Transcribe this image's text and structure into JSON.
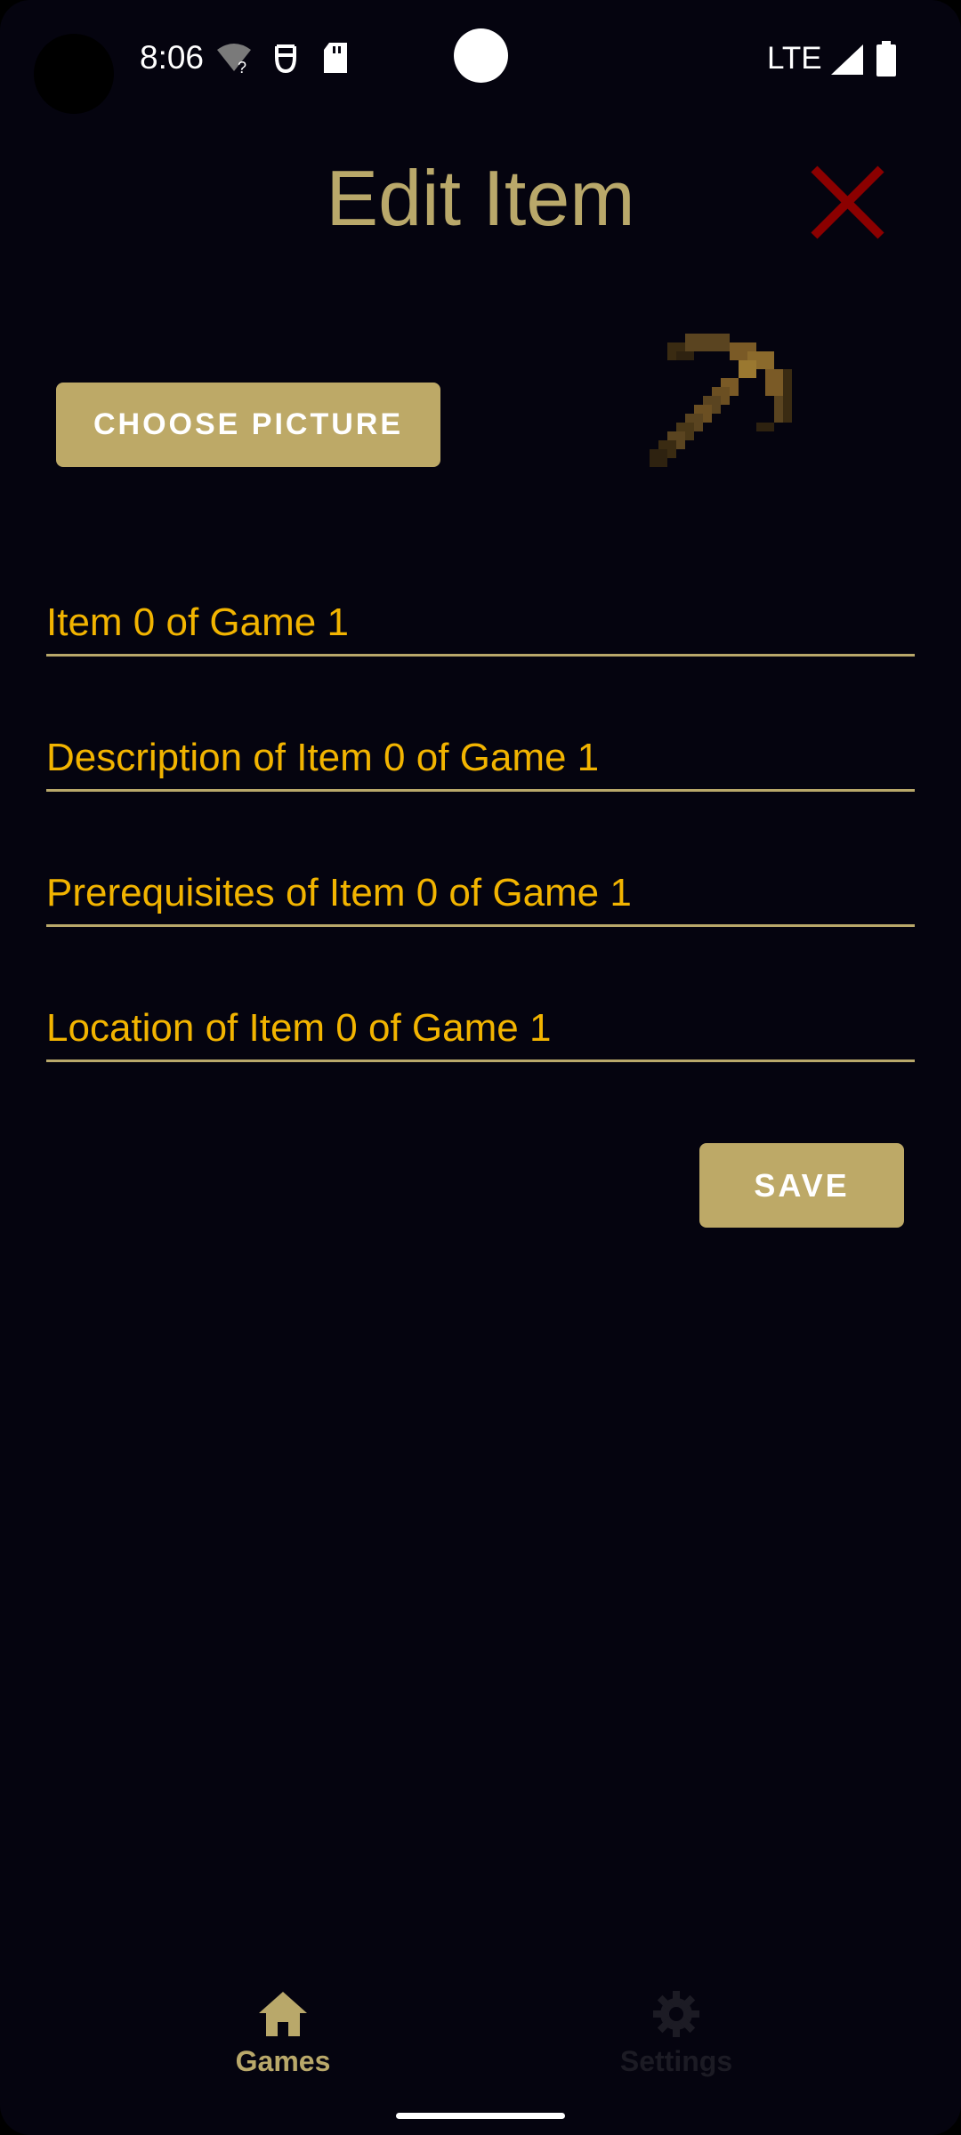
{
  "status_bar": {
    "time": "8:06",
    "network": "LTE",
    "icons": [
      "wifi-unknown-icon",
      "face-icon",
      "sd-card-icon",
      "signal-icon",
      "battery-icon"
    ]
  },
  "header": {
    "title": "Edit Item",
    "close_icon": "close-icon"
  },
  "picture": {
    "choose_label": "CHOOSE PICTURE",
    "image_icon": "pickaxe-image"
  },
  "form": {
    "fields": [
      {
        "name": "item-name-field",
        "value": "Item 0 of Game 1"
      },
      {
        "name": "item-description-field",
        "value": "Description of Item 0 of Game 1"
      },
      {
        "name": "item-prerequisites-field",
        "value": "Prerequisites of Item 0 of Game 1"
      },
      {
        "name": "item-location-field",
        "value": "Location of Item 0 of Game 1"
      }
    ],
    "save_label": "SAVE"
  },
  "bottom_nav": {
    "items": [
      {
        "label": "Games",
        "icon": "home-icon",
        "selected": true
      },
      {
        "label": "Settings",
        "icon": "gear-icon",
        "selected": false
      }
    ]
  },
  "colors": {
    "background": "#05040f",
    "accent": "#b9a86a",
    "field_text": "#f2b400",
    "close": "#8b0000"
  }
}
